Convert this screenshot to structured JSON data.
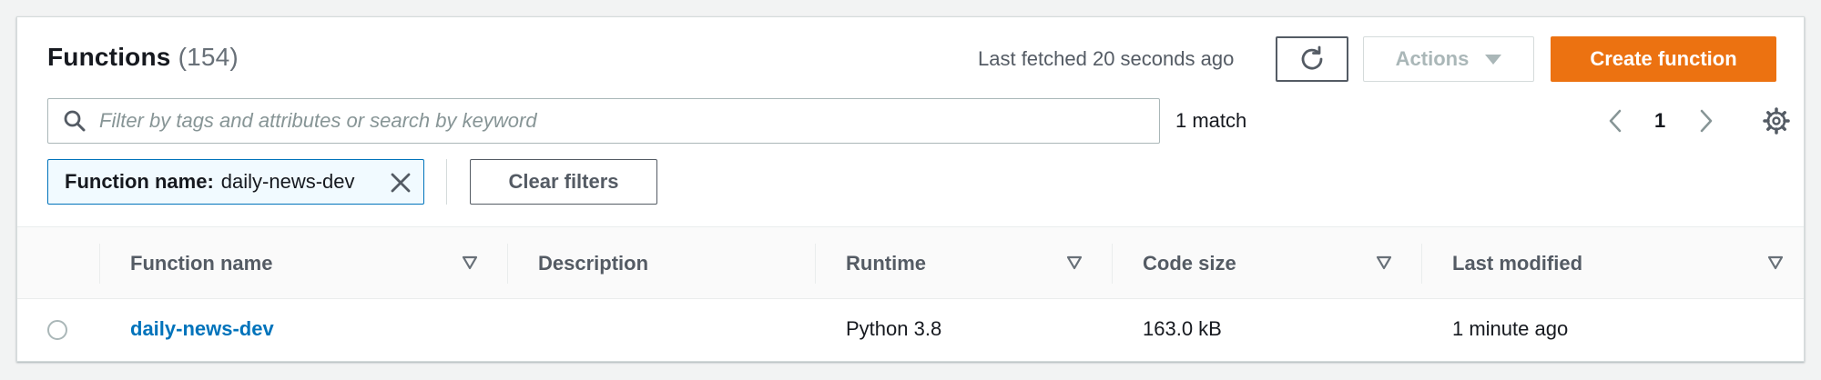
{
  "header": {
    "title": "Functions",
    "count": "(154)",
    "last_fetched": "Last fetched 20 seconds ago",
    "actions_label": "Actions",
    "create_label": "Create function"
  },
  "filter": {
    "placeholder": "Filter by tags and attributes or search by keyword",
    "match_count": "1 match",
    "token_key": "Function name:",
    "token_value": "daily-news-dev",
    "clear_label": "Clear filters"
  },
  "pagination": {
    "current_page": "1"
  },
  "table": {
    "columns": [
      "Function name",
      "Description",
      "Runtime",
      "Code size",
      "Last modified"
    ],
    "rows": [
      {
        "function_name": "daily-news-dev",
        "description": "",
        "runtime": "Python 3.8",
        "code_size": "163.0 kB",
        "last_modified": "1 minute ago"
      }
    ]
  },
  "icons": {
    "refresh": "refresh-icon",
    "actions_caret": "caret-down-icon",
    "search": "search-icon",
    "prev": "chevron-left-icon",
    "next": "chevron-right-icon",
    "settings": "gear-icon",
    "dismiss": "close-icon",
    "sort": "sort-icon"
  },
  "colors": {
    "primary_button": "#ec7211",
    "link": "#0073bb",
    "token_border": "#0073bb"
  }
}
